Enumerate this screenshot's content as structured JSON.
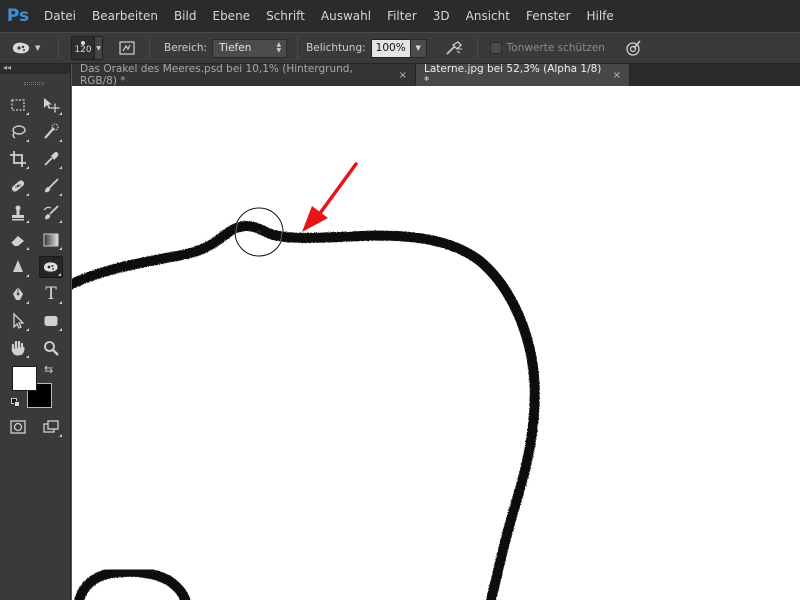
{
  "app": {
    "logo": "Ps"
  },
  "menu": [
    "Datei",
    "Bearbeiten",
    "Bild",
    "Ebene",
    "Schrift",
    "Auswahl",
    "Filter",
    "3D",
    "Ansicht",
    "Fenster",
    "Hilfe"
  ],
  "options": {
    "tool_icon": "sponge-icon",
    "brush_size": "120",
    "range_label": "Bereich:",
    "range_value": "Tiefen",
    "exposure_label": "Belichtung:",
    "exposure_value": "100%",
    "protect_label": "Tonwerte schützen",
    "protect_checked": false
  },
  "tabs": [
    {
      "label": "Das Orakel des Meeres.psd bei 10,1% (Hintergrund, RGB/8) *",
      "close": "×",
      "active": false
    },
    {
      "label": "Laterne.jpg bei 52,3% (Alpha 1/8) *",
      "close": "×",
      "active": true
    }
  ],
  "tools": {
    "left": [
      "marquee-icon",
      "lasso-icon",
      "crop-icon",
      "healing-brush-icon",
      "stamp-icon",
      "eraser-icon",
      "blur-icon",
      "pen-icon",
      "path-selection-icon",
      "hand-icon"
    ],
    "right": [
      "move-icon",
      "quick-selection-icon",
      "eyedropper-icon",
      "brush-icon",
      "history-brush-icon",
      "gradient-icon",
      "sponge-icon",
      "type-icon",
      "rectangle-icon",
      "zoom-icon"
    ],
    "type_glyph": "T",
    "foreground_color": "#ffffff",
    "background_color": "#000000"
  },
  "colors": {
    "annotation_arrow": "#e8141a",
    "canvas": "#ffffff",
    "stroke": "#000000"
  }
}
